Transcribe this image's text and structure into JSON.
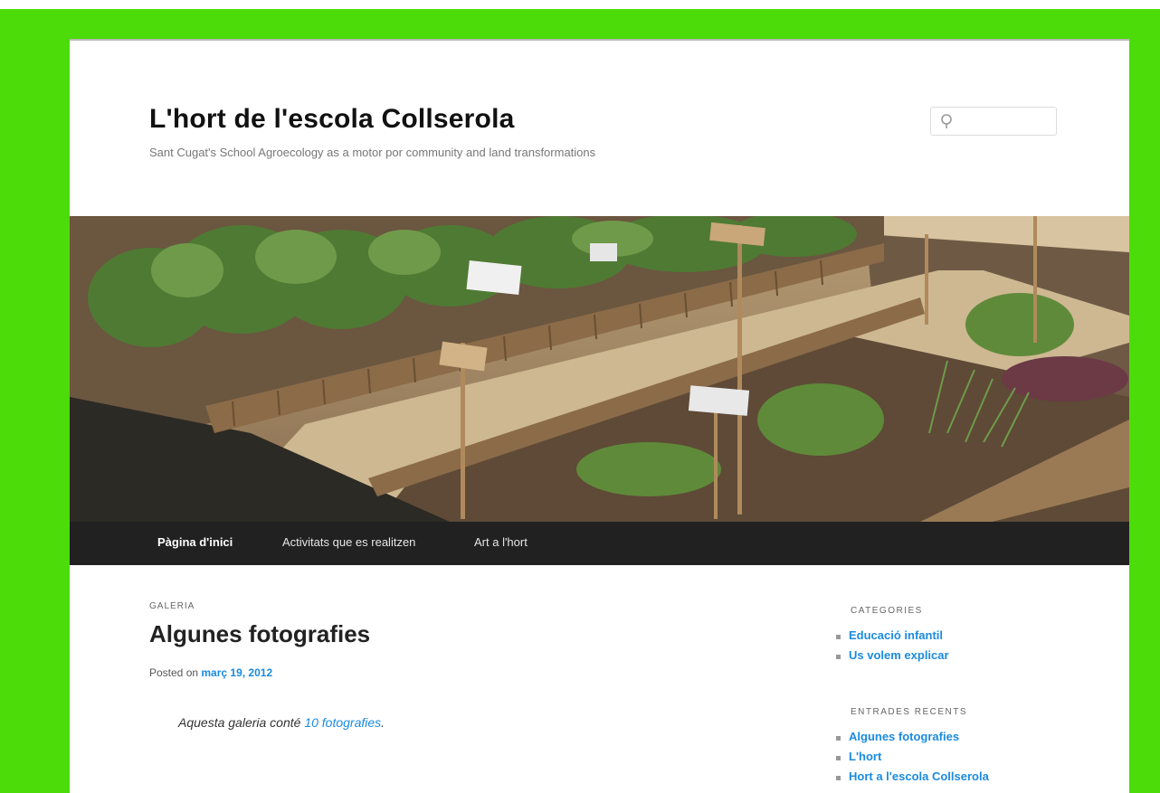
{
  "site": {
    "title": "L'hort de l'escola Collserola",
    "description": "Sant Cugat's School Agroecology as a motor por community and land transformations"
  },
  "search": {
    "icon": "search-icon",
    "value": ""
  },
  "banner": {
    "alt": "Garden beds with wooden edging and plant markers"
  },
  "nav": {
    "items": [
      {
        "label": "Pàgina d'inici",
        "active": true
      },
      {
        "label": "Activitats que es realitzen",
        "active": false
      },
      {
        "label": "Art a l'hort",
        "active": false
      }
    ]
  },
  "post": {
    "format": "GALERIA",
    "title": "Algunes fotografies",
    "meta_prefix": "Posted on",
    "date": "març 19, 2012",
    "content_prefix": "Aquesta galeria conté",
    "content_link": "10 fotografies",
    "content_suffix": "."
  },
  "sidebar": {
    "categories_title": "CATEGORIES",
    "categories": [
      "Educació infantil",
      "Us volem explicar"
    ],
    "recent_title": "ENTRADES RECENTS",
    "recent": [
      "Algunes fotografies",
      "L'hort",
      "Hort a l'escola Collserola"
    ]
  },
  "colors": {
    "frame": "#4cdc0a",
    "nav_bg": "#212121",
    "link": "#1b8be0"
  }
}
